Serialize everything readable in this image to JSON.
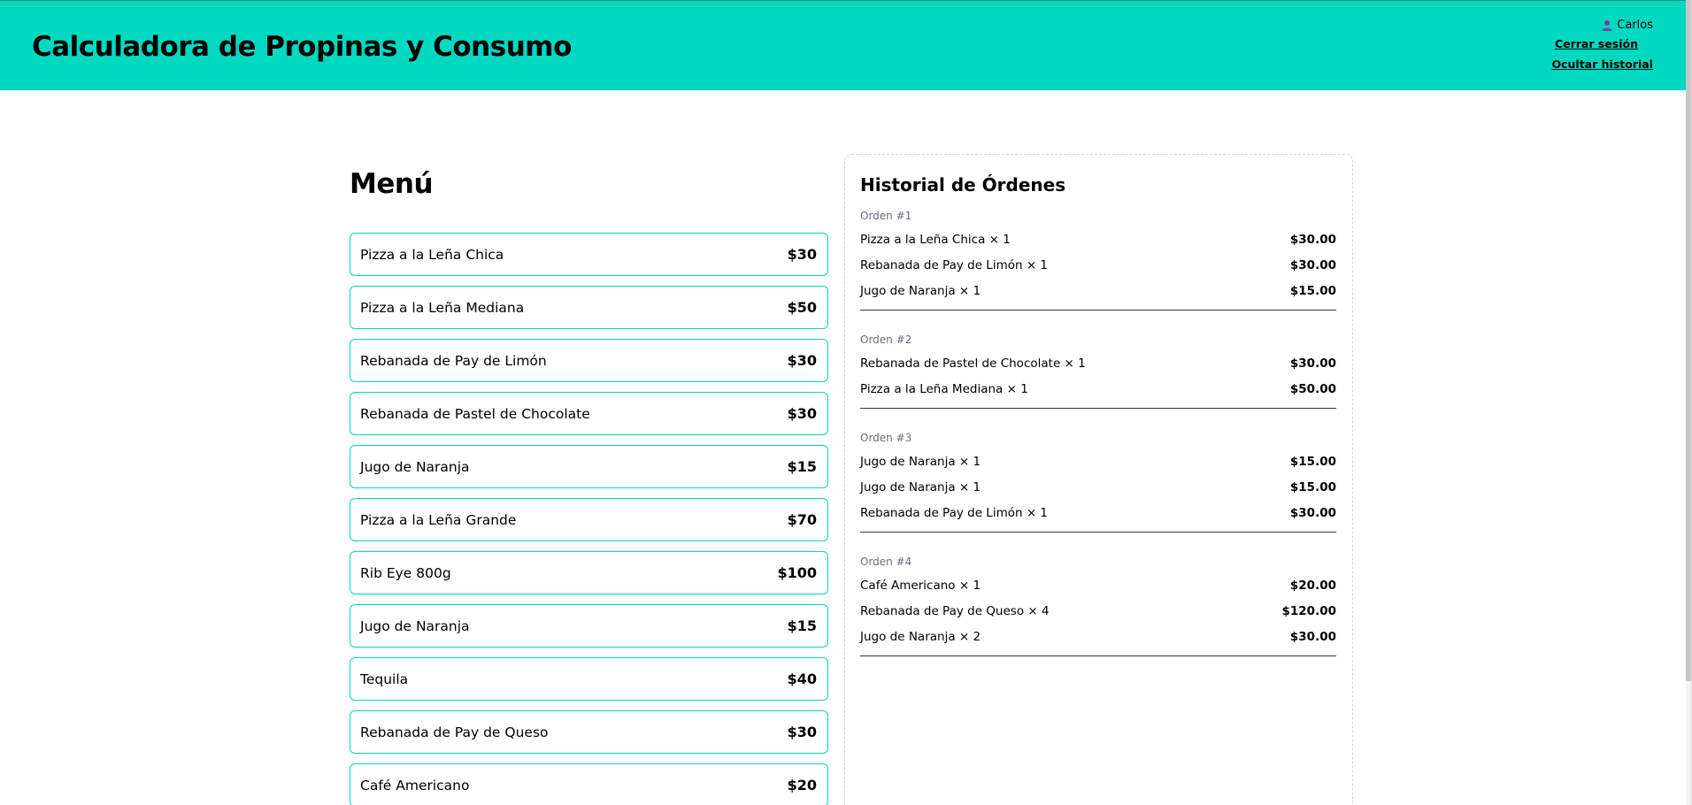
{
  "header": {
    "title": "Calculadora de Propinas y Consumo",
    "user_name": "Carlos",
    "user_icon": "user-icon",
    "logout_label": "Cerrar sesión",
    "toggle_history_label": "Ocultar historial",
    "accent_color": "#00d9c0"
  },
  "menu": {
    "title": "Menú",
    "items": [
      {
        "name": "Pizza a la Leña Chica",
        "price": "$30"
      },
      {
        "name": "Pizza a la Leña Mediana",
        "price": "$50"
      },
      {
        "name": "Rebanada de Pay de Limón",
        "price": "$30"
      },
      {
        "name": "Rebanada de Pastel de Chocolate",
        "price": "$30"
      },
      {
        "name": "Jugo de Naranja",
        "price": "$15"
      },
      {
        "name": "Pizza a la Leña Grande",
        "price": "$70"
      },
      {
        "name": "Rib Eye 800g",
        "price": "$100"
      },
      {
        "name": "Jugo de Naranja",
        "price": "$15"
      },
      {
        "name": "Tequila",
        "price": "$40"
      },
      {
        "name": "Rebanada de Pay de Queso",
        "price": "$30"
      },
      {
        "name": "Café Americano",
        "price": "$20"
      }
    ]
  },
  "history": {
    "title": "Historial de Órdenes",
    "orders": [
      {
        "label": "Orden #1",
        "lines": [
          {
            "item": "Pizza a la Leña Chica × 1",
            "amount": "$30.00"
          },
          {
            "item": "Rebanada de Pay de Limón × 1",
            "amount": "$30.00"
          },
          {
            "item": "Jugo de Naranja × 1",
            "amount": "$15.00"
          }
        ]
      },
      {
        "label": "Orden #2",
        "lines": [
          {
            "item": "Rebanada de Pastel de Chocolate × 1",
            "amount": "$30.00"
          },
          {
            "item": "Pizza a la Leña Mediana × 1",
            "amount": "$50.00"
          }
        ]
      },
      {
        "label": "Orden #3",
        "lines": [
          {
            "item": "Jugo de Naranja × 1",
            "amount": "$15.00"
          },
          {
            "item": "Jugo de Naranja × 1",
            "amount": "$15.00"
          },
          {
            "item": "Rebanada de Pay de Limón × 1",
            "amount": "$30.00"
          }
        ]
      },
      {
        "label": "Orden #4",
        "lines": [
          {
            "item": "Café Americano × 1",
            "amount": "$20.00"
          },
          {
            "item": "Rebanada de Pay de Queso × 4",
            "amount": "$120.00"
          },
          {
            "item": "Jugo de Naranja × 2",
            "amount": "$30.00"
          }
        ]
      }
    ]
  }
}
